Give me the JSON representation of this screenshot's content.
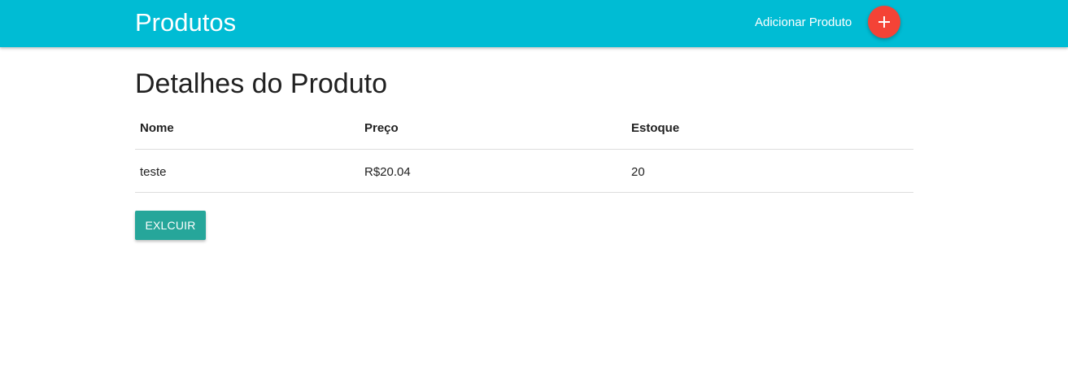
{
  "navbar": {
    "brand": "Produtos",
    "add_link": "Adicionar Produto",
    "add_button_icon": "plus-icon",
    "background_color": "#00bcd4",
    "fab_color": "#f44336"
  },
  "main": {
    "title": "Detalhes do Produto",
    "table": {
      "headers": [
        "Nome",
        "Preço",
        "Estoque"
      ],
      "rows": [
        [
          "teste",
          "R$20.04",
          "20"
        ]
      ]
    },
    "delete_button": {
      "label": "EXLCUIR",
      "color": "#26a69a"
    }
  }
}
